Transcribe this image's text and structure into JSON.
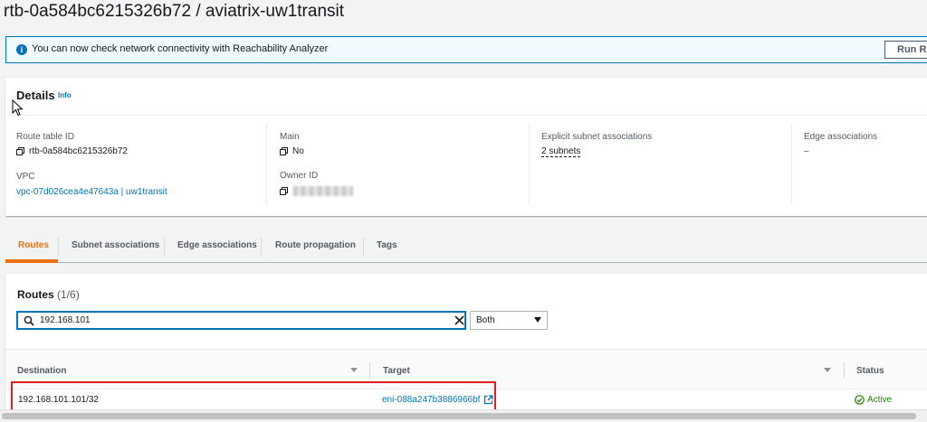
{
  "page": {
    "title": "rtb-0a584bc6215326b72 / aviatrix-uw1transit"
  },
  "banner": {
    "message": "You can now check network connectivity with Reachability Analyzer",
    "button": "Run Reachability Analyzer"
  },
  "details": {
    "title": "Details",
    "info": "Info",
    "route_table_id": {
      "label": "Route table ID",
      "value": "rtb-0a584bc6215326b72"
    },
    "vpc": {
      "label": "VPC",
      "value": "vpc-07d026cea4e47643a | uw1transit"
    },
    "main": {
      "label": "Main",
      "value": "No"
    },
    "owner_id": {
      "label": "Owner ID",
      "value": ""
    },
    "explicit_subnet": {
      "label": "Explicit subnet associations",
      "value": "2 subnets"
    },
    "edge_assoc": {
      "label": "Edge associations",
      "value": "–"
    }
  },
  "tabs": [
    "Routes",
    "Subnet associations",
    "Edge associations",
    "Route propagation",
    "Tags"
  ],
  "routes": {
    "title": "Routes",
    "count": "(1/6)",
    "search_value": "192.168.101",
    "filter": "Both",
    "columns": [
      "Destination",
      "Target",
      "Status"
    ],
    "rows": [
      {
        "destination": "192.168.101.101/32",
        "target": "eni-088a247b3886966bf",
        "status": "Active"
      }
    ]
  },
  "colors": {
    "link": "#0073bb",
    "accent": "#ec7211",
    "success": "#1d8102",
    "highlight": "#e02020"
  }
}
